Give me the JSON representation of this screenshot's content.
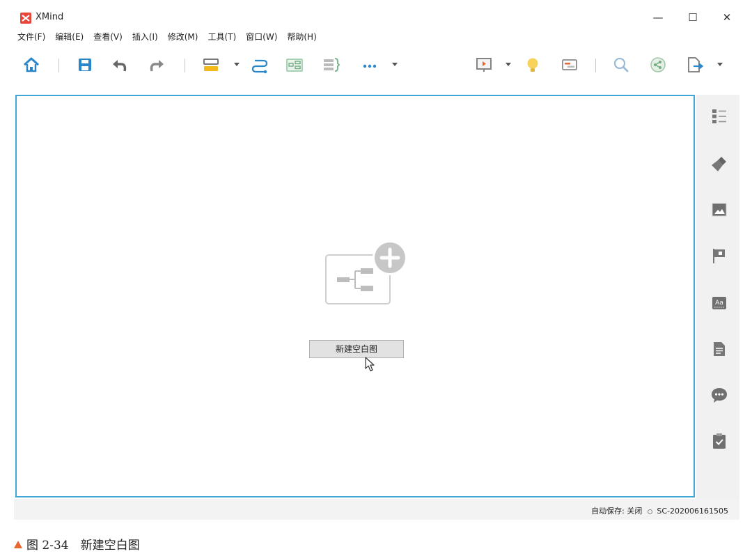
{
  "app": {
    "title": "XMind",
    "logo_color": "#e8463a",
    "window_controls": [
      "—",
      "☐",
      "✕"
    ]
  },
  "menu": [
    {
      "label": "文件(F)"
    },
    {
      "label": "编辑(E)"
    },
    {
      "label": "查看(V)"
    },
    {
      "label": "插入(I)"
    },
    {
      "label": "修改(M)"
    },
    {
      "label": "工具(T)"
    },
    {
      "label": "窗口(W)"
    },
    {
      "label": "帮助(H)"
    }
  ],
  "toolbar": {
    "icons": [
      "home-icon",
      "save-icon",
      "undo-icon",
      "redo-icon",
      "topic-icon",
      "relationship-icon",
      "summary-icon",
      "boundary-icon",
      "more-icon",
      "presentation-icon",
      "idea-icon",
      "gantt-icon",
      "search-icon",
      "share-icon",
      "export-icon"
    ]
  },
  "canvas": {
    "border_color": "#3fa6d8",
    "new_blank_label": "新建空白图"
  },
  "right_panel": {
    "icons": [
      "outline-icon",
      "format-brush-icon",
      "image-icon",
      "flag-icon",
      "font-icon",
      "note-icon",
      "comment-icon",
      "task-icon"
    ]
  },
  "status": {
    "autosave": "自动保存: 关闭",
    "file": "SC-202006161505"
  },
  "caption": {
    "text": "图 2-34　新建空白图",
    "marker_color": "#e8662f"
  }
}
